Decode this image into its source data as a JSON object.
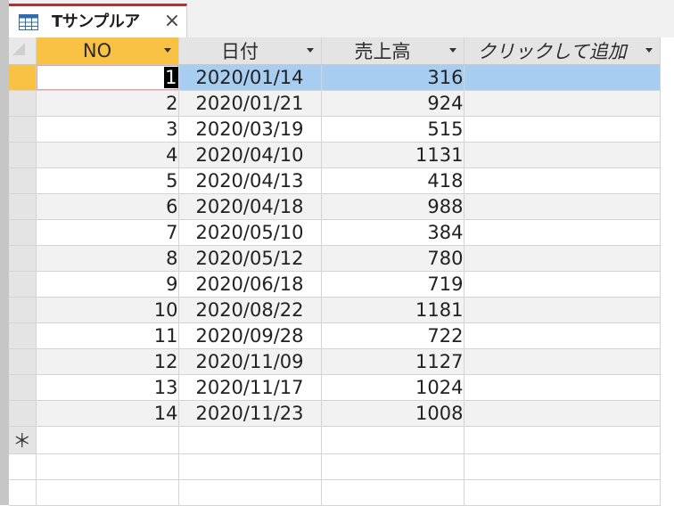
{
  "tab": {
    "title": "Tサンプルア",
    "close_glyph": "×",
    "icon": "table-icon"
  },
  "columns": [
    {
      "label": "NO"
    },
    {
      "label": "日付"
    },
    {
      "label": "売上高"
    },
    {
      "label": "クリックして追加"
    }
  ],
  "rows": [
    {
      "no": "1",
      "date": "2020/01/14",
      "sales": "316"
    },
    {
      "no": "2",
      "date": "2020/01/21",
      "sales": "924"
    },
    {
      "no": "3",
      "date": "2020/03/19",
      "sales": "515"
    },
    {
      "no": "4",
      "date": "2020/04/10",
      "sales": "1131"
    },
    {
      "no": "5",
      "date": "2020/04/13",
      "sales": "418"
    },
    {
      "no": "6",
      "date": "2020/04/18",
      "sales": "988"
    },
    {
      "no": "7",
      "date": "2020/05/10",
      "sales": "384"
    },
    {
      "no": "8",
      "date": "2020/05/12",
      "sales": "780"
    },
    {
      "no": "9",
      "date": "2020/06/18",
      "sales": "719"
    },
    {
      "no": "10",
      "date": "2020/08/22",
      "sales": "1181"
    },
    {
      "no": "11",
      "date": "2020/09/28",
      "sales": "722"
    },
    {
      "no": "12",
      "date": "2020/11/09",
      "sales": "1127"
    },
    {
      "no": "13",
      "date": "2020/11/17",
      "sales": "1024"
    },
    {
      "no": "14",
      "date": "2020/11/23",
      "sales": "1008"
    }
  ],
  "new_record_glyph": "＊",
  "colors": {
    "tab_accent": "#a4373a",
    "current_selector": "#f8c244",
    "selection_highlight": "#a7cdf0"
  }
}
